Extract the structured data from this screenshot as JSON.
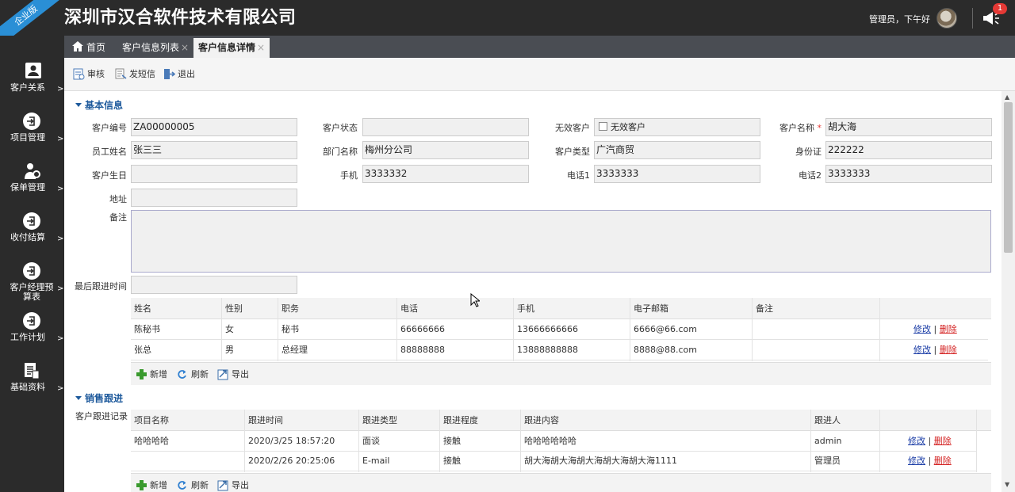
{
  "header": {
    "edition_ribbon": "企业版",
    "company": "深圳市汉合软件技术有限公司",
    "greeting": "管理员，下午好",
    "notification_count": "1"
  },
  "sidebar": {
    "items": [
      {
        "label": "客户关系",
        "icon": "person-card-icon"
      },
      {
        "label": "项目管理",
        "icon": "login-arrow-icon"
      },
      {
        "label": "保单管理",
        "icon": "person-gear-icon"
      },
      {
        "label": "收付结算",
        "icon": "login-arrow-icon"
      },
      {
        "label": "客户经理预算表",
        "icon": "login-arrow-icon"
      },
      {
        "label": "工作计划",
        "icon": "login-arrow-icon"
      },
      {
        "label": "基础资料",
        "icon": "document-list-icon"
      }
    ],
    "arrow": ">"
  },
  "tabs": [
    {
      "label": "首页",
      "closable": false
    },
    {
      "label": "客户信息列表",
      "closable": true
    },
    {
      "label": "客户信息详情",
      "closable": true,
      "active": true
    }
  ],
  "tab_close": "×",
  "toolbar": {
    "audit": "审核",
    "sms": "发短信",
    "exit": "退出"
  },
  "basic": {
    "section_title": "基本信息",
    "labels": {
      "customer_no": "客户编号",
      "customer_status": "客户状态",
      "invalid_customer": "无效客户",
      "customer_name": "客户名称",
      "employee": "员工姓名",
      "department": "部门名称",
      "customer_type": "客户类型",
      "id_card": "身份证",
      "birthday": "客户生日",
      "mobile": "手机",
      "phone1": "电话1",
      "phone2": "电话2",
      "address": "地址",
      "remark": "备注",
      "last_follow": "最后跟进时间"
    },
    "required_mark": "*",
    "values": {
      "customer_no": "ZA00000005",
      "customer_status": "",
      "invalid_checkbox_label": "无效客户",
      "customer_name": "胡大海",
      "employee": "张三三",
      "department": "梅州分公司",
      "customer_type": "广汽商贸",
      "id_card": "222222",
      "birthday": "",
      "mobile": "3333332",
      "phone1": "3333333",
      "phone2": "3333333",
      "address": "",
      "remark": "",
      "last_follow": ""
    }
  },
  "contacts": {
    "columns": [
      "姓名",
      "性别",
      "职务",
      "电话",
      "手机",
      "电子邮箱",
      "备注"
    ],
    "rows": [
      [
        "陈秘书",
        "女",
        "秘书",
        "66666666",
        "13666666666",
        "6666@66.com",
        ""
      ],
      [
        "张总",
        "男",
        "总经理",
        "88888888",
        "13888888888",
        "8888@88.com",
        ""
      ]
    ],
    "edit": "修改",
    "sep": "|",
    "delete": "删除",
    "footer": {
      "add": "新增",
      "refresh": "刷新",
      "export": "导出"
    }
  },
  "sales": {
    "section_title": "销售跟进",
    "record_label": "客户跟进记录",
    "columns": [
      "项目名称",
      "跟进时间",
      "跟进类型",
      "跟进程度",
      "跟进内容",
      "跟进人"
    ],
    "rows": [
      [
        "哈哈哈哈",
        "2020/3/25 18:57:20",
        "面谈",
        "接触",
        "哈哈哈哈哈哈",
        "admin"
      ],
      [
        "",
        "2020/2/26 20:25:06",
        "E-mail",
        "接触",
        "胡大海胡大海胡大海胡大海胡大海1111",
        "管理员"
      ]
    ],
    "edit": "修改",
    "sep": "|",
    "delete": "删除",
    "footer": {
      "add": "新增",
      "refresh": "刷新",
      "export": "导出"
    }
  },
  "colors": {
    "dark": "#2b2b2b",
    "tabbar": "#4a4d53",
    "accent": "#1e5a9c",
    "ribbon": "#2a8fd6",
    "danger": "#d42222",
    "link": "#1a3ca6"
  }
}
